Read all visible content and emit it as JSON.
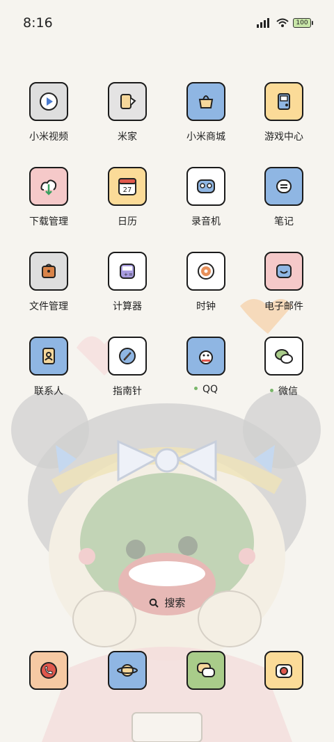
{
  "status_bar": {
    "time": "8:16",
    "battery_level": "100"
  },
  "apps": [
    {
      "label": "小米视频",
      "icon": "video-play-icon",
      "bg": "#dedede"
    },
    {
      "label": "米家",
      "icon": "mijia-icon",
      "bg": "#e4e3e3"
    },
    {
      "label": "小米商城",
      "icon": "store-icon",
      "bg": "#8fb6e3"
    },
    {
      "label": "游戏中心",
      "icon": "gamepad-icon",
      "bg": "#fbdb98"
    },
    {
      "label": "下载管理",
      "icon": "download-cloud-icon",
      "bg": "#f5c9c9"
    },
    {
      "label": "日历",
      "icon": "calendar-icon",
      "bg": "#fbdb98",
      "calendar_day": "27"
    },
    {
      "label": "录音机",
      "icon": "recorder-icon",
      "bg": "#ffffff"
    },
    {
      "label": "笔记",
      "icon": "notes-icon",
      "bg": "#8fb6e3"
    },
    {
      "label": "文件管理",
      "icon": "folder-bag-icon",
      "bg": "#dedede"
    },
    {
      "label": "计算器",
      "icon": "calculator-icon",
      "bg": "#ffffff"
    },
    {
      "label": "时钟",
      "icon": "clock-icon",
      "bg": "#ffffff"
    },
    {
      "label": "电子邮件",
      "icon": "mail-icon",
      "bg": "#f5c9c9"
    },
    {
      "label": "联系人",
      "icon": "contacts-icon",
      "bg": "#8fb6e3"
    },
    {
      "label": "指南针",
      "icon": "compass-icon",
      "bg": "#ffffff"
    },
    {
      "label": "QQ",
      "icon": "qq-penguin-icon",
      "bg": "#8fb6e3",
      "new_dot": true
    },
    {
      "label": "微信",
      "icon": "wechat-icon",
      "bg": "#ffffff",
      "new_dot": true
    }
  ],
  "search": {
    "label": "搜索"
  },
  "dock": [
    {
      "icon": "phone-icon",
      "bg": "#f6c9a3"
    },
    {
      "icon": "browser-planet-icon",
      "bg": "#8fb6e3"
    },
    {
      "icon": "messages-icon",
      "bg": "#a9cc8a"
    },
    {
      "icon": "camera-icon",
      "bg": "#fbdb98"
    }
  ]
}
